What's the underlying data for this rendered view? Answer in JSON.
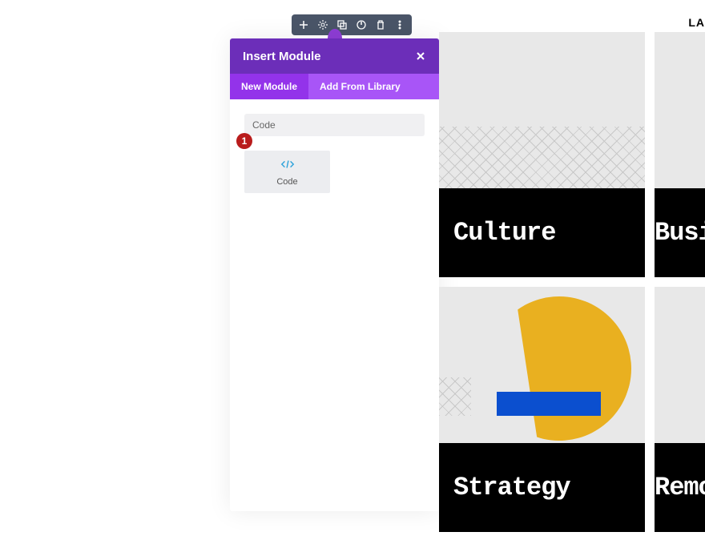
{
  "top_right": "LA",
  "toolbar": {
    "icons": [
      "plus",
      "gear",
      "duplicate",
      "power",
      "trash",
      "more"
    ]
  },
  "modal": {
    "title": "Insert Module",
    "tabs": {
      "new": "New Module",
      "library": "Add From Library"
    },
    "search_value": "Code",
    "module": {
      "label": "Code"
    }
  },
  "annotation": {
    "badge": "1"
  },
  "cards": {
    "c1": "Culture",
    "c2": "Busi",
    "c3": "Strategy",
    "c4": "Remo"
  }
}
